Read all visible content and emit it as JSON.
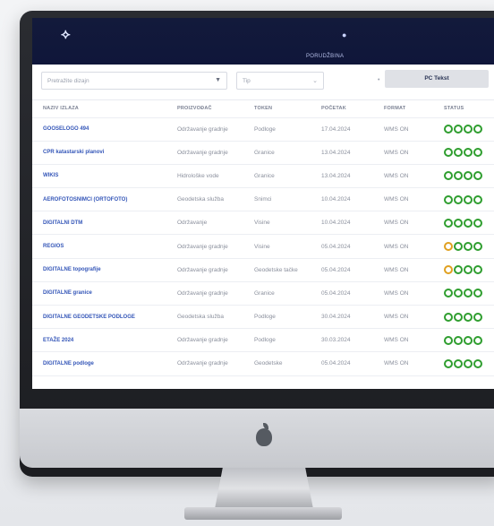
{
  "header": {
    "crumbs": [
      "",
      "",
      "PORUDŽBINA"
    ]
  },
  "filters": {
    "search_placeholder": "Pretražite dizajn",
    "type_placeholder": "Tip",
    "button_label": "PC Tekst"
  },
  "table": {
    "columns": [
      "NAZIV IZLAZA",
      "PROIZVOĐAČ",
      "TOKEN",
      "POČETAK",
      "FORMAT",
      "STATUS"
    ],
    "rows": [
      {
        "name": "GOOSELOGO 494",
        "maker": "Održavanje gradnje",
        "token": "Podloge",
        "date": "17.04.2024",
        "format": "WMS  ON",
        "status": [
          "ok",
          "ok",
          "ok",
          "ok"
        ]
      },
      {
        "name": "CPR katastarski planovi",
        "maker": "Održavanje gradnje",
        "token": "Granice",
        "date": "13.04.2024",
        "format": "WMS  ON",
        "status": [
          "ok",
          "ok",
          "ok",
          "ok"
        ]
      },
      {
        "name": "WIKIS",
        "maker": "Hidrološke vode",
        "token": "Granice",
        "date": "13.04.2024",
        "format": "WMS  ON",
        "status": [
          "ok",
          "ok",
          "ok",
          "ok"
        ]
      },
      {
        "name": "AEROFOTOSNIMCI (ORTOFOTO)",
        "maker": "Geodetska služba",
        "token": "Snimci",
        "date": "10.04.2024",
        "format": "WMS  ON",
        "status": [
          "ok",
          "ok",
          "ok",
          "ok"
        ]
      },
      {
        "name": "DIGITALNI DTM",
        "maker": "Održavanje",
        "token": "Visine",
        "date": "10.04.2024",
        "format": "WMS  ON",
        "status": [
          "ok",
          "ok",
          "ok",
          "ok"
        ]
      },
      {
        "name": "REGIOS",
        "maker": "Održavanje gradnje",
        "token": "Visine",
        "date": "05.04.2024",
        "format": "WMS  ON",
        "status": [
          "warn",
          "ok",
          "ok",
          "ok"
        ]
      },
      {
        "name": "DIGITALNE topografije",
        "maker": "Održavanje gradnje",
        "token": "Geodetske tačke",
        "date": "05.04.2024",
        "format": "WMS  ON",
        "status": [
          "warn",
          "ok",
          "ok",
          "ok"
        ]
      },
      {
        "name": "DIGITALNE granice",
        "maker": "Održavanje gradnje",
        "token": "Granice",
        "date": "05.04.2024",
        "format": "WMS  ON",
        "status": [
          "ok",
          "ok",
          "ok",
          "ok"
        ]
      },
      {
        "name": "DIGITALNE GEODETSKE PODLOGE",
        "maker": "Geodetska služba",
        "token": "Podloge",
        "date": "30.04.2024",
        "format": "WMS  ON",
        "status": [
          "ok",
          "ok",
          "ok",
          "ok"
        ]
      },
      {
        "name": "ETAŽE 2024",
        "maker": "Održavanje gradnje",
        "token": "Podloge",
        "date": "30.03.2024",
        "format": "WMS  ON",
        "status": [
          "ok",
          "ok",
          "ok",
          "ok"
        ]
      },
      {
        "name": "DIGITALNE podloge",
        "maker": "Održavanje gradnje",
        "token": "Geodetske",
        "date": "05.04.2024",
        "format": "WMS  ON",
        "status": [
          "ok",
          "ok",
          "ok",
          "ok"
        ]
      }
    ]
  },
  "colors": {
    "header_bg": "#131a3b",
    "ok": "#2f9e2f",
    "warn": "#e0a020",
    "link": "#3456b8"
  }
}
